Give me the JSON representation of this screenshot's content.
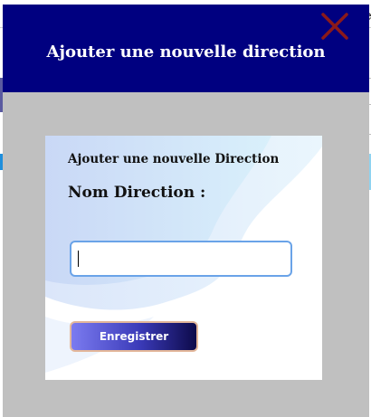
{
  "modal": {
    "title": "Ajouter une nouvelle direction",
    "close_icon": "close-x-icon",
    "close_color": "#8b1a1a",
    "header_color": "#000080",
    "body_color": "#c0c0c0"
  },
  "form": {
    "heading": "Ajouter une nouvelle Direction",
    "label": "Nom Direction :",
    "input_value": "",
    "input_placeholder": "",
    "save_label": "Enregistrer"
  },
  "background": {
    "partial_text": "e"
  }
}
